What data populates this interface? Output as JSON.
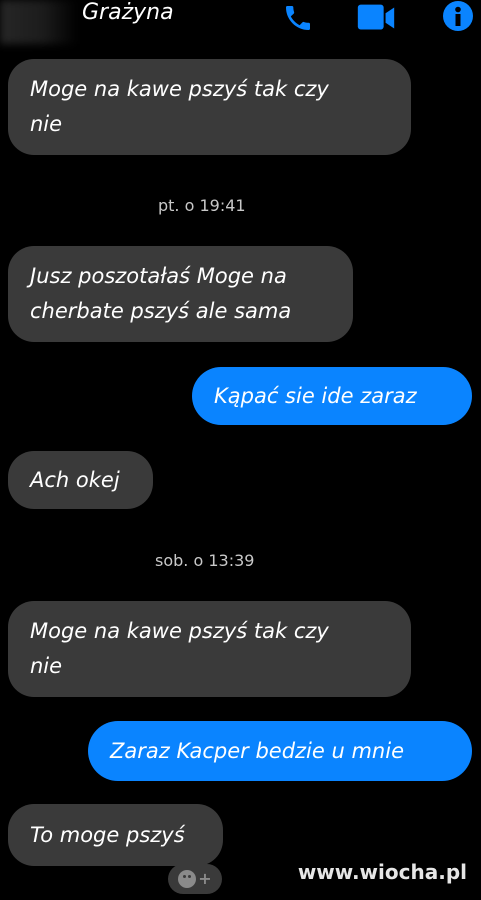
{
  "header": {
    "contact_name": "Grażyna",
    "icons": [
      "phone-icon",
      "video-camera-icon",
      "info-icon"
    ],
    "accent_color": "#0a84ff"
  },
  "messages": [
    {
      "direction": "incoming",
      "text": "Moge na kawe pszyś tak czy\nnie"
    },
    {
      "timestamp": "pt. o 19:41"
    },
    {
      "direction": "incoming",
      "text": "Jusz poszotałaś Moge na\ncherbate pszyś ale sama"
    },
    {
      "direction": "outgoing",
      "text": "Kąpać sie ide zaraz"
    },
    {
      "direction": "incoming",
      "text": "Ach okej"
    },
    {
      "timestamp": "sob. o 13:39"
    },
    {
      "direction": "incoming",
      "text": "Moge na kawe pszyś tak czy\nnie"
    },
    {
      "direction": "outgoing",
      "text": "Zaraz Kacper bedzie u mnie"
    },
    {
      "direction": "incoming",
      "text": "To moge pszyś"
    }
  ],
  "reaction_button": {
    "icon": "emoji-add-icon",
    "label": "+"
  },
  "watermark": "www.wiocha.pl",
  "colors": {
    "background": "#000000",
    "incoming_bubble": "#3a3a3a",
    "outgoing_bubble": "#0a84ff",
    "timestamp_text": "#c8c8c8"
  }
}
